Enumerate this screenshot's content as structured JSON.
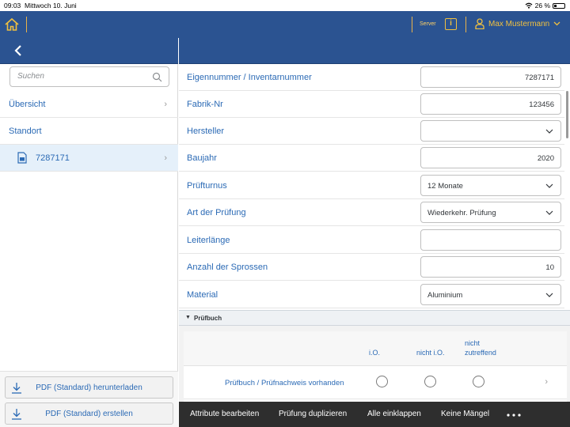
{
  "statusbar": {
    "time": "09:03",
    "date": "Mittwoch 10. Juni",
    "battery": "26 %"
  },
  "shell": {
    "server_label": "Server",
    "info_label": "i",
    "user_name": "Max Mustermann"
  },
  "search": {
    "placeholder": "Suchen"
  },
  "nav": {
    "items": [
      {
        "label": "Übersicht"
      },
      {
        "label": "Standort"
      },
      {
        "label": "7287171"
      }
    ]
  },
  "left_buttons": {
    "download": "PDF (Standard) herunterladen",
    "create": "PDF (Standard) erstellen"
  },
  "form": {
    "fields": [
      {
        "label": "Eigennummer / Inventarnummer",
        "value": "7287171"
      },
      {
        "label": "Fabrik-Nr",
        "value": "123456"
      },
      {
        "label": "Hersteller",
        "value": ""
      },
      {
        "label": "Baujahr",
        "value": "2020"
      },
      {
        "label": "Prüfturnus",
        "value": "12 Monate"
      },
      {
        "label": "Art der Prüfung",
        "value": "Wiederkehr. Prüfung"
      },
      {
        "label": "Leiterlänge",
        "value": ""
      },
      {
        "label": "Anzahl der Sprossen",
        "value": "10"
      },
      {
        "label": "Material",
        "value": "Aluminium"
      }
    ]
  },
  "pruefbuch": {
    "title": "Prüfbuch",
    "columns": [
      "i.O.",
      "nicht i.O.",
      "nicht",
      "zutreffend"
    ],
    "row_label": "Prüfbuch / Prüfnachweis vorhanden"
  },
  "footer": {
    "edit": "Attribute bearbeiten",
    "duplicate": "Prüfung duplizieren",
    "collapse": "Alle einklappen",
    "no_defects": "Keine Mängel"
  },
  "colors": {
    "shell": "#2b5391",
    "accent": "#f0c040",
    "link": "#2b6ab5",
    "footer": "#2e2e2e"
  }
}
